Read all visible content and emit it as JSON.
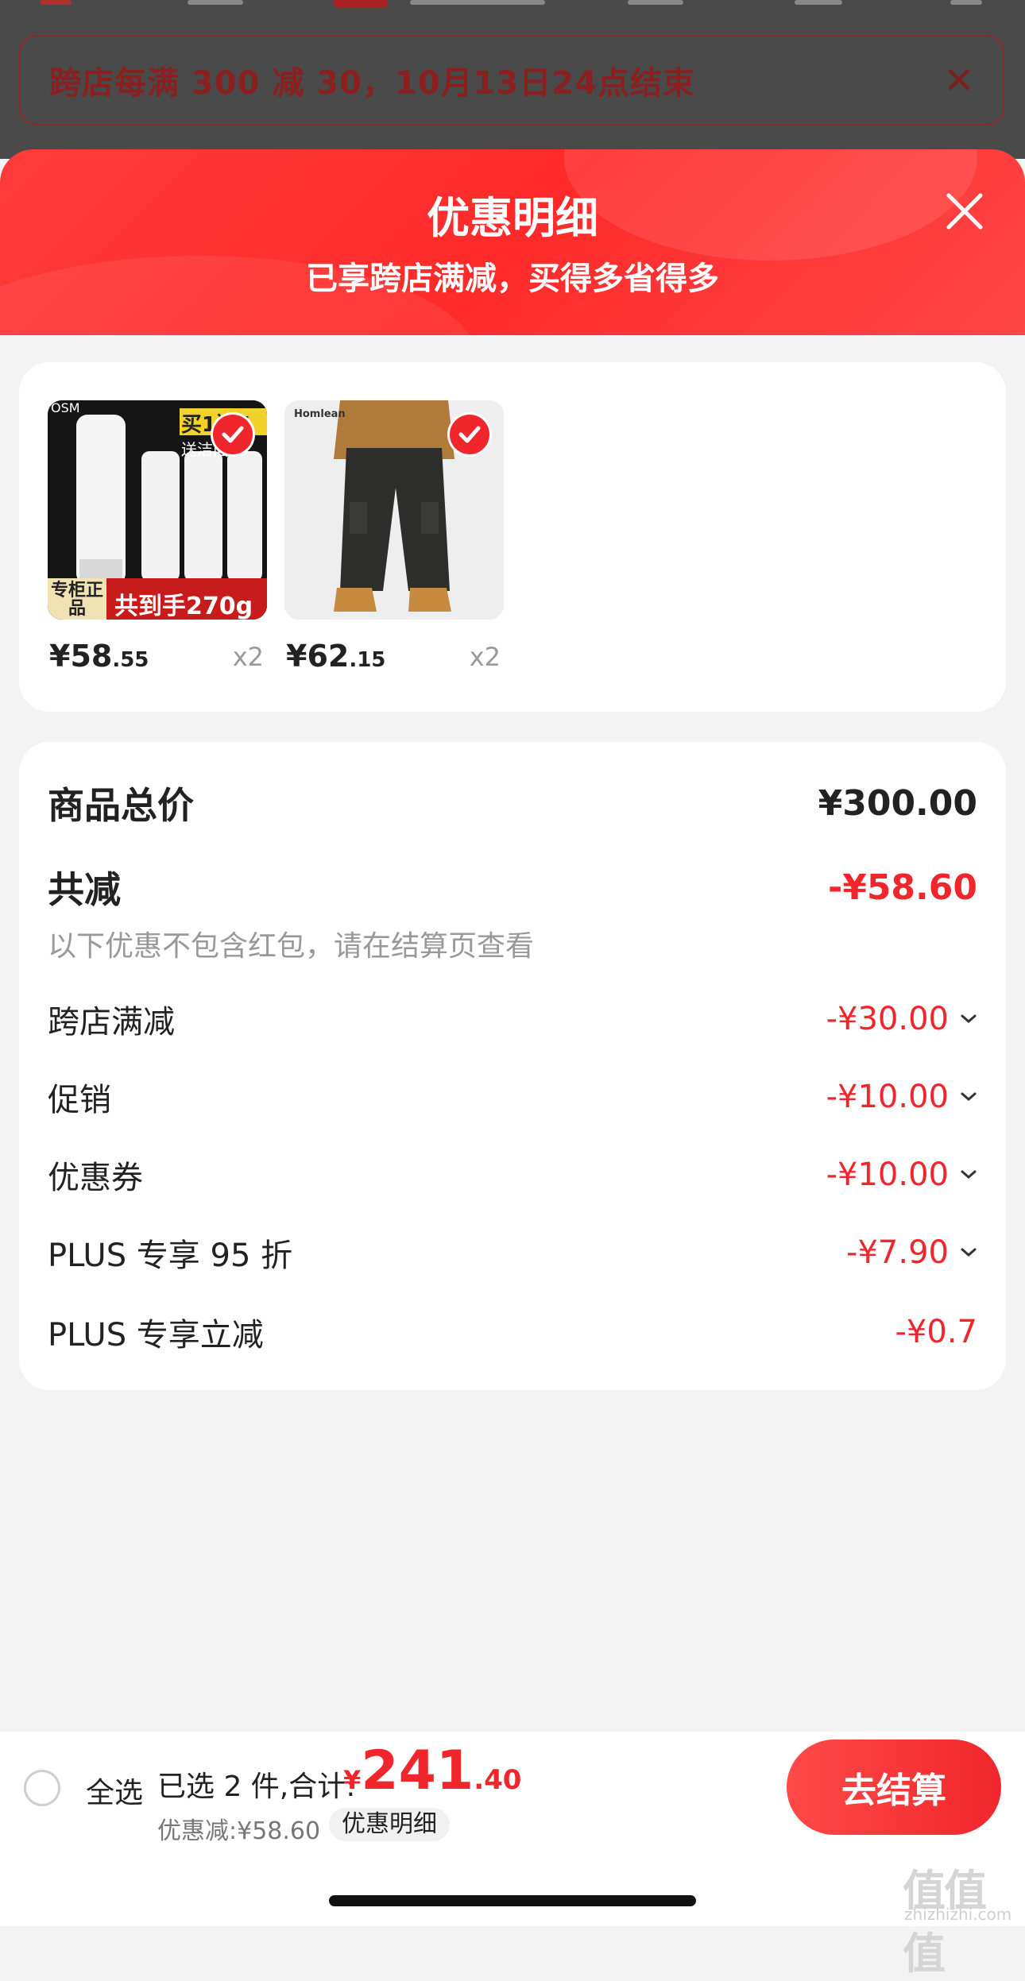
{
  "banner": {
    "text": "跨店每满 300 减 30，10月13日24点结束",
    "close_icon": "close-icon"
  },
  "sheet": {
    "title": "优惠明细",
    "subtitle": "已享跨店满减，买得多省得多",
    "close_icon": "close-icon",
    "header_color": "#ff2a2a"
  },
  "products": [
    {
      "brand_text": "OSM",
      "promo_top": "买1送4",
      "promo_sub": "送洁面",
      "badge_left": "专柜正品",
      "badge_right": "共到手270g",
      "price_int": "¥58",
      "price_dec": ".55",
      "qty": "x2",
      "selected": true
    },
    {
      "brand_text": "Homlean",
      "price_int": "¥62",
      "price_dec": ".15",
      "qty": "x2",
      "selected": true
    }
  ],
  "detail": {
    "total_label": "商品总价",
    "total_value": "¥300.00",
    "reduce_label": "共减",
    "reduce_value": "-¥58.60",
    "note": "以下优惠不包含红包，请在结算页查看",
    "items": [
      {
        "label": "跨店满减",
        "value": "-¥30.00",
        "expandable": true
      },
      {
        "label": "促销",
        "value": "-¥10.00",
        "expandable": true
      },
      {
        "label": "优惠券",
        "value": "-¥10.00",
        "expandable": true
      },
      {
        "label": "PLUS 专享 95 折",
        "value": "-¥7.90",
        "expandable": true
      },
      {
        "label": "PLUS 专享立减",
        "value": "-¥0.7",
        "expandable": false
      }
    ]
  },
  "bottom_bar": {
    "select_all": "全选",
    "selected_text": "已选 2 件,合计:",
    "total_currency": "¥",
    "total_int": "241",
    "total_dec": ".40",
    "discount_text": "优惠减:¥58.60",
    "detail_link": "优惠明细",
    "checkout": "去结算"
  },
  "watermark": {
    "text": "值值值",
    "sub": "zhizhizhi.com"
  },
  "colors": {
    "accent": "#f0262c",
    "text": "#222222",
    "muted": "#999999"
  }
}
